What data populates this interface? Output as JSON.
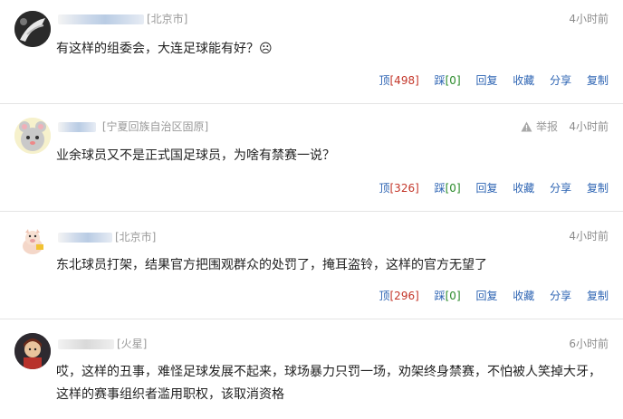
{
  "labels": {
    "up": "顶",
    "down": "踩",
    "reply": "回复",
    "favorite": "收藏",
    "share": "分享",
    "copy": "复制",
    "report": "举报"
  },
  "comments": [
    {
      "location": "[北京市]",
      "time": "4小时前",
      "text": "有这样的组委会，大连足球能有好？☹",
      "up": "[498]",
      "down": "[0]"
    },
    {
      "location": "[宁夏回族自治区固原]",
      "time": "4小时前",
      "text": "业余球员又不是正式国足球员，为啥有禁赛一说？",
      "up": "[326]",
      "down": "[0]"
    },
    {
      "location": "[北京市]",
      "time": "4小时前",
      "text": "东北球员打架，结果官方把围观群众的处罚了，掩耳盗铃，这样的官方无望了",
      "up": "[296]",
      "down": "[0]"
    },
    {
      "location": "[火星]",
      "time": "6小时前",
      "text": "哎，这样的丑事，难怪足球发展不起来，球场暴力只罚一场，劝架终身禁赛，不怕被人笑掉大牙，这样的赛事组织者滥用职权，该取消资格"
    }
  ]
}
